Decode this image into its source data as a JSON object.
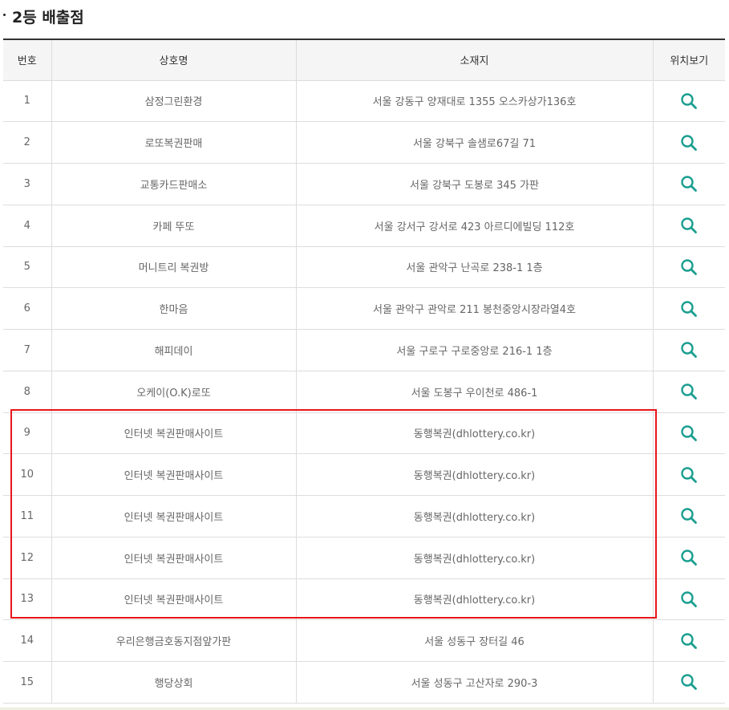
{
  "section": {
    "title": "2등 배출점"
  },
  "table": {
    "headers": {
      "num": "번호",
      "name": "상호명",
      "address": "소재지",
      "location": "위치보기"
    },
    "rows": [
      {
        "num": "1",
        "name": "삼정그린환경",
        "address": "서울 강동구 양재대로 1355 오스카상가136호"
      },
      {
        "num": "2",
        "name": "로또복권판매",
        "address": "서울 강북구 솔샘로67길 71"
      },
      {
        "num": "3",
        "name": "교통카드판매소",
        "address": "서울 강북구 도봉로 345 가판"
      },
      {
        "num": "4",
        "name": "카페 뚜또",
        "address": "서울 강서구 강서로 423 아르디에빌딩 112호"
      },
      {
        "num": "5",
        "name": "머니트리 복권방",
        "address": "서울 관악구 난곡로 238-1 1층"
      },
      {
        "num": "6",
        "name": "한마음",
        "address": "서울 관악구 관악로 211 봉천중앙시장라열4호"
      },
      {
        "num": "7",
        "name": "해피데이",
        "address": "서울 구로구 구로중앙로 216-1 1층"
      },
      {
        "num": "8",
        "name": "오케이(O.K)로또",
        "address": "서울 도봉구 우이천로 486-1"
      },
      {
        "num": "9",
        "name": "인터넷 복권판매사이트",
        "address": "동행복권(dhlottery.co.kr)"
      },
      {
        "num": "10",
        "name": "인터넷 복권판매사이트",
        "address": "동행복권(dhlottery.co.kr)"
      },
      {
        "num": "11",
        "name": "인터넷 복권판매사이트",
        "address": "동행복권(dhlottery.co.kr)"
      },
      {
        "num": "12",
        "name": "인터넷 복권판매사이트",
        "address": "동행복권(dhlottery.co.kr)"
      },
      {
        "num": "13",
        "name": "인터넷 복권판매사이트",
        "address": "동행복권(dhlottery.co.kr)"
      },
      {
        "num": "14",
        "name": "우리은행금호동지점앞가판",
        "address": "서울 성동구 장터길 46"
      },
      {
        "num": "15",
        "name": "행당상회",
        "address": "서울 성동구 고산자로 290-3"
      }
    ],
    "location_icon": "search-icon"
  },
  "colors": {
    "icon": "#1a9e8f",
    "highlight": "#e8151b",
    "header_bg": "#f5f5f5",
    "header_top_border": "#333333",
    "grid": "#dddddd"
  }
}
